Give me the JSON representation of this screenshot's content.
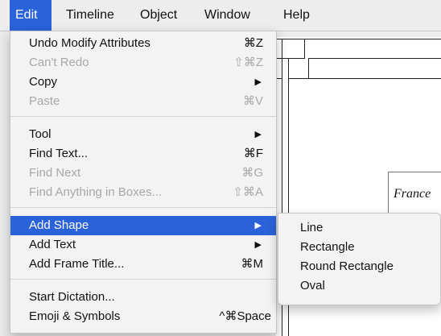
{
  "menubar": {
    "items": [
      "Edit",
      "Timeline",
      "Object",
      "Window",
      "Help"
    ]
  },
  "document": {
    "textbox_text": "France"
  },
  "edit_menu": {
    "items": [
      {
        "label": "Undo Modify Attributes",
        "shortcut": "⌘Z",
        "enabled": true
      },
      {
        "label": "Can't Redo",
        "shortcut": "⇧⌘Z",
        "enabled": false
      },
      {
        "label": "Copy",
        "shortcut": "▶",
        "enabled": true
      },
      {
        "label": "Paste",
        "shortcut": "⌘V",
        "enabled": false
      },
      {
        "label": "Tool",
        "shortcut": "▶",
        "enabled": true
      },
      {
        "label": "Find Text...",
        "shortcut": "⌘F",
        "enabled": true
      },
      {
        "label": "Find Next",
        "shortcut": "⌘G",
        "enabled": false
      },
      {
        "label": "Find Anything in Boxes...",
        "shortcut": "⇧⌘A",
        "enabled": false
      },
      {
        "label": "Add Shape",
        "shortcut": "▶",
        "enabled": true,
        "highlighted": true
      },
      {
        "label": "Add Text",
        "shortcut": "▶",
        "enabled": true
      },
      {
        "label": "Add Frame Title...",
        "shortcut": "⌘M",
        "enabled": true
      },
      {
        "label": "Start Dictation...",
        "shortcut": "",
        "enabled": true
      },
      {
        "label": "Emoji & Symbols",
        "shortcut": "^⌘Space",
        "enabled": true
      }
    ]
  },
  "shape_submenu": {
    "items": [
      "Line",
      "Rectangle",
      "Round Rectangle",
      "Oval"
    ]
  },
  "colors": {
    "highlight": "#2a62d9",
    "menu_background": "#f3f3f3",
    "disabled_text": "#a8a8a8"
  }
}
